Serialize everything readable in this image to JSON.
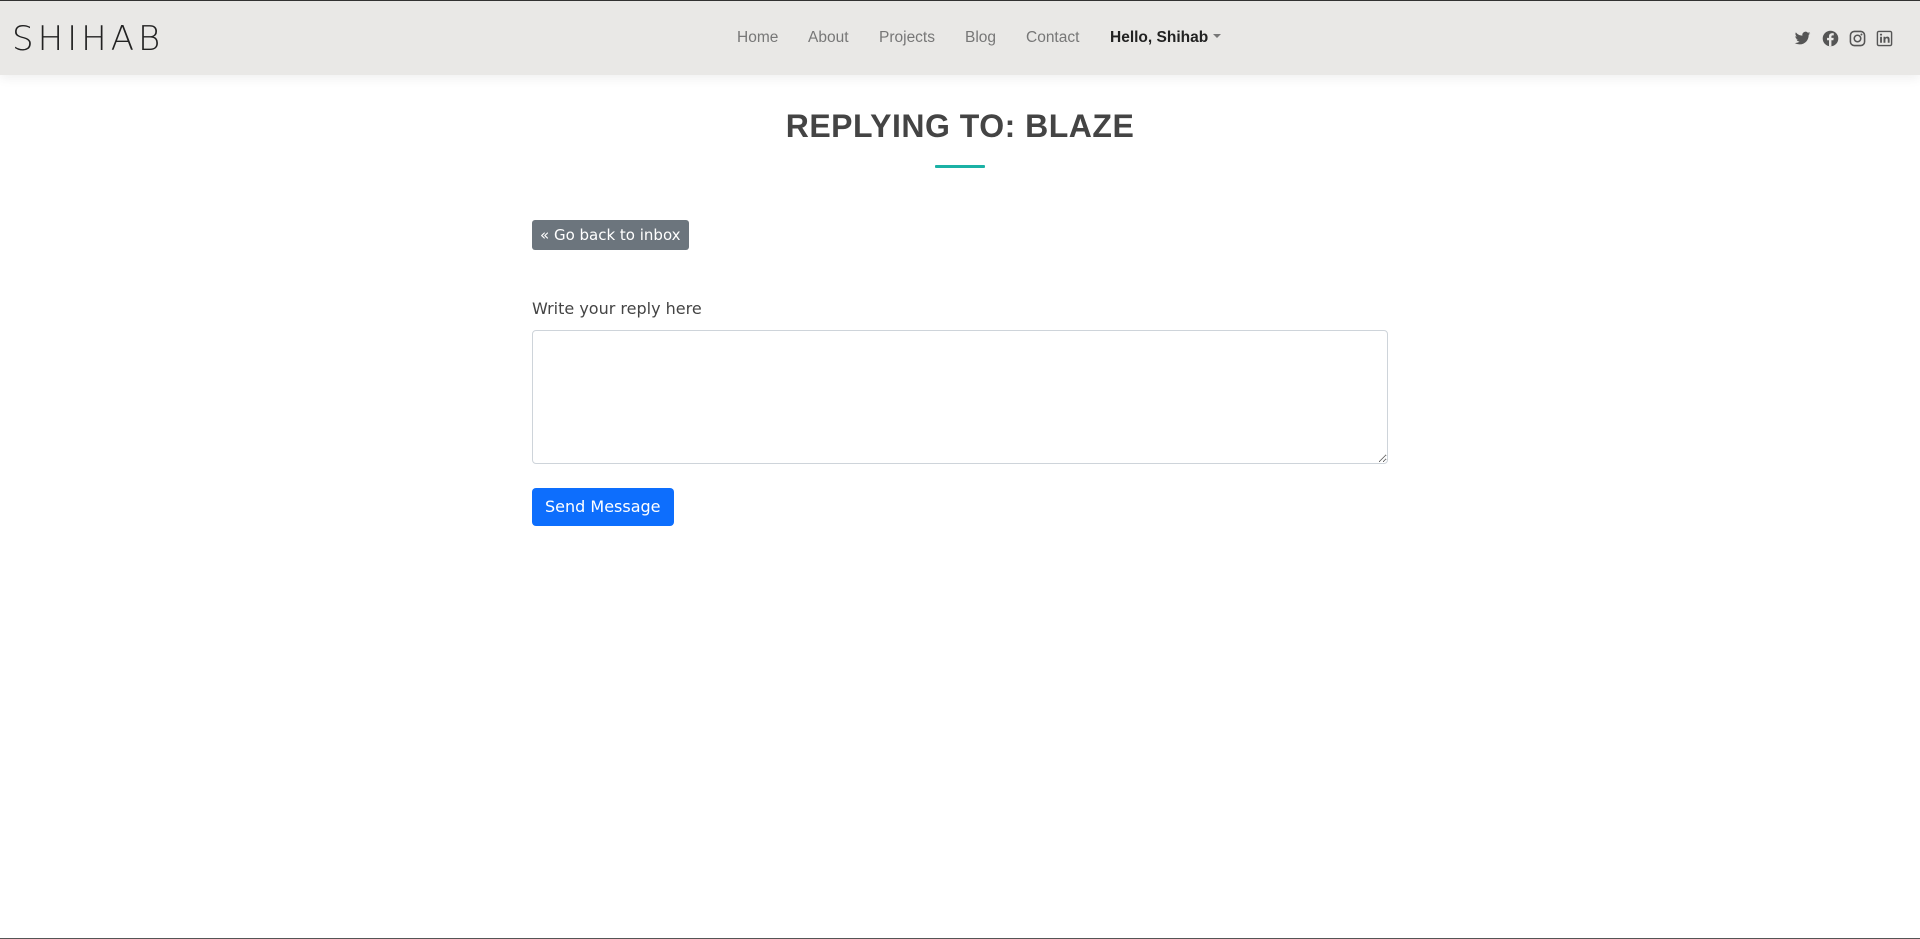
{
  "brand": "SHIHAB",
  "nav": {
    "items": [
      {
        "label": "Home"
      },
      {
        "label": "About"
      },
      {
        "label": "Projects"
      },
      {
        "label": "Blog"
      },
      {
        "label": "Contact"
      }
    ],
    "user_greeting": "Hello, Shihab"
  },
  "social": [
    "twitter-icon",
    "facebook-icon",
    "instagram-icon",
    "linkedin-icon"
  ],
  "page": {
    "title": "REPLYING TO: BLAZE",
    "back_label": "« Go back to inbox",
    "reply_label": "Write your reply here",
    "reply_value": "",
    "send_label": "Send Message"
  },
  "colors": {
    "accent": "#1bb1a5",
    "primary_button": "#0d6efd",
    "secondary_button": "#6c757d",
    "navbar_bg": "#e9e8e6"
  }
}
